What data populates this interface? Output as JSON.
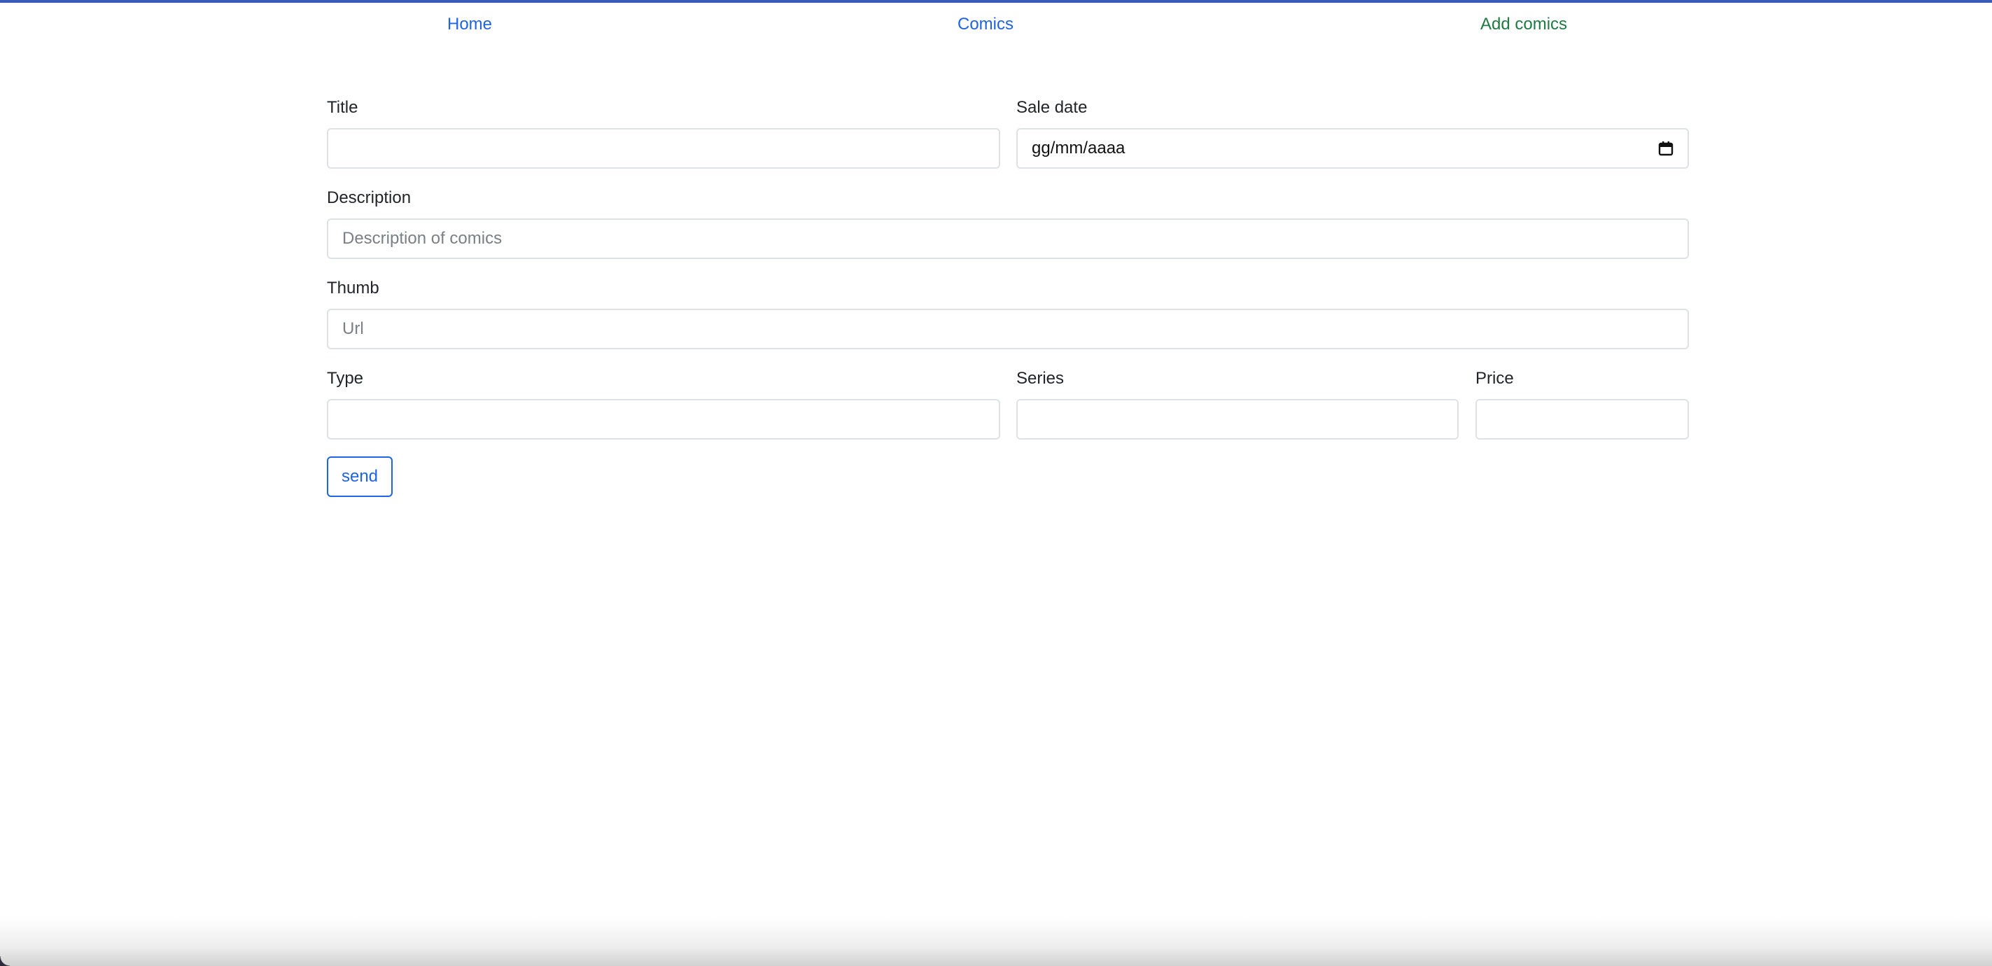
{
  "nav": {
    "home": "Home",
    "comics": "Comics",
    "add_comics": "Add comics"
  },
  "form": {
    "title": {
      "label": "Title",
      "value": "",
      "placeholder": ""
    },
    "sale_date": {
      "label": "Sale date",
      "placeholder": "gg/mm/aaaa"
    },
    "description": {
      "label": "Description",
      "value": "",
      "placeholder": "Description of comics"
    },
    "thumb": {
      "label": "Thumb",
      "value": "",
      "placeholder": "Url"
    },
    "type": {
      "label": "Type",
      "value": "",
      "placeholder": ""
    },
    "series": {
      "label": "Series",
      "value": "",
      "placeholder": ""
    },
    "price": {
      "label": "Price",
      "value": "",
      "placeholder": ""
    },
    "submit_label": "send"
  },
  "colors": {
    "link": "#1f63e6",
    "active_link": "#1f7a42",
    "top_border": "#3b5bb8",
    "input_border": "#dee2e6"
  },
  "icons": {
    "date_picker": "calendar-icon"
  }
}
